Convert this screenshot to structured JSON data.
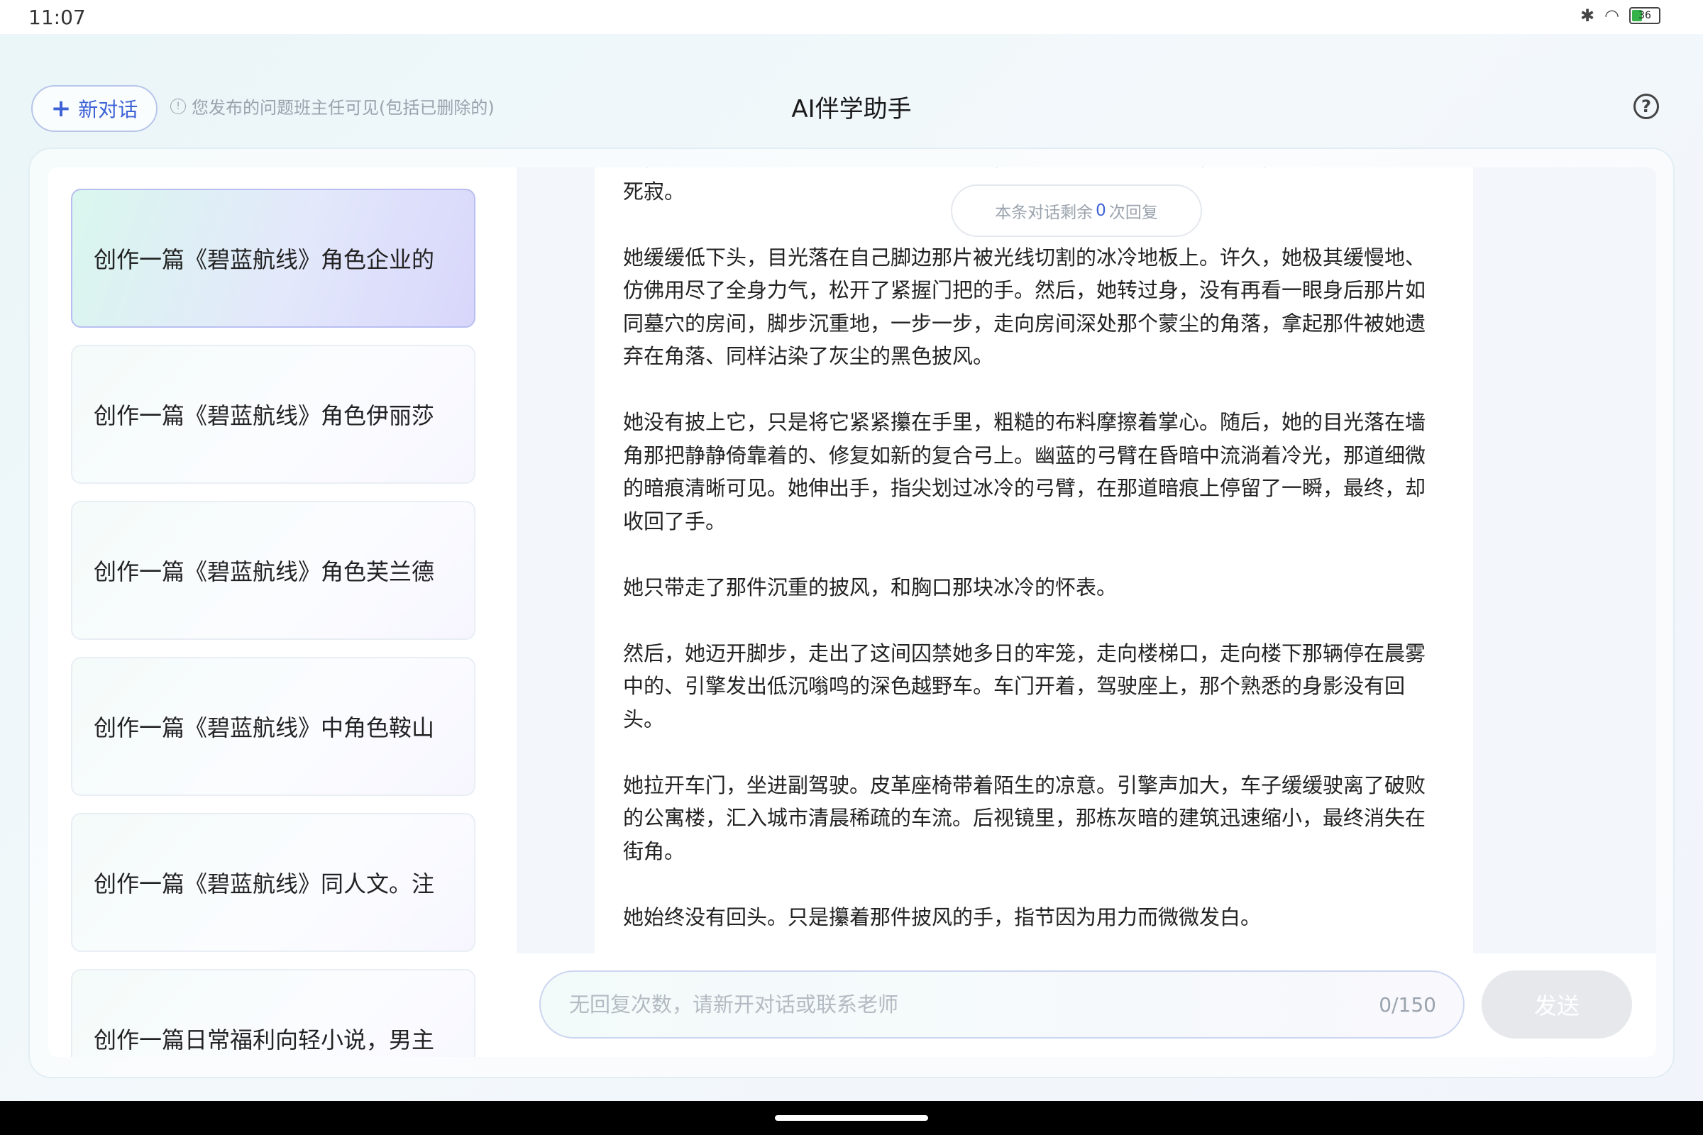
{
  "status_bar": {
    "time": "11:07",
    "battery_level": "36",
    "icons": [
      "bluetooth-icon",
      "wifi-icon",
      "battery-icon"
    ]
  },
  "header": {
    "new_chat_label": "新对话",
    "notice": "您发布的问题班主任可见(包括已删除的)",
    "title": "AI伴学助手"
  },
  "sidebar": {
    "items": [
      {
        "label": "创作一篇《碧蓝航线》角色企业的",
        "active": true
      },
      {
        "label": "创作一篇《碧蓝航线》角色伊丽莎",
        "active": false
      },
      {
        "label": "创作一篇《碧蓝航线》角色芙兰德",
        "active": false
      },
      {
        "label": "创作一篇《碧蓝航线》中角色鞍山",
        "active": false
      },
      {
        "label": "创作一篇《碧蓝航线》同人文。注",
        "active": false
      },
      {
        "label": "创作一篇日常福利向轻小说，男主",
        "active": false
      }
    ]
  },
  "chat": {
    "remaining_prefix": "本条对话剩余",
    "remaining_count": "0",
    "remaining_suffix": "次回复",
    "paragraphs": [
      "来，在地板上投下一道狭长的光带。门外，是喧嚣而陌生的世界，门内，是凝固的黑暗与死寂。",
      "她缓缓低下头，目光落在自己脚边那片被光线切割的冰冷地板上。许久，她极其缓慢地、仿佛用尽了全身力气，松开了紧握门把的手。然后，她转过身，没有再看一眼身后那片如同墓穴的房间，脚步沉重地，一步一步，走向房间深处那个蒙尘的角落，拿起那件被她遗弃在角落、同样沾染了灰尘的黑色披风。",
      "她没有披上它，只是将它紧紧攥在手里，粗糙的布料摩擦着掌心。随后，她的目光落在墙角那把静静倚靠着的、修复如新的复合弓上。幽蓝的弓臂在昏暗中流淌着冷光，那道细微的暗痕清晰可见。她伸出手，指尖划过冰冷的弓臂，在那道暗痕上停留了一瞬，最终，却收回了手。",
      "她只带走了那件沉重的披风，和胸口那块冰冷的怀表。",
      "然后，她迈开脚步，走出了这间囚禁她多日的牢笼，走向楼梯口，走向楼下那辆停在晨雾中的、引擎发出低沉嗡鸣的深色越野车。车门开着，驾驶座上，那个熟悉的身影没有回头。",
      "她拉开车门，坐进副驾驶。皮革座椅带着陌生的凉意。引擎声加大，车子缓缓驶离了破败的公寓楼，汇入城市清晨稀疏的车流。后视镜里，那栋灰暗的建筑迅速缩小，最终消失在街角。",
      "她始终没有回头。只是攥着那件披风的手，指节因为用力而微微发白。"
    ]
  },
  "input": {
    "placeholder": "无回复次数，请新开对话或联系老师",
    "char_count": "0/150",
    "send_label": "发送"
  },
  "colors": {
    "accent": "#3d62d6",
    "active_item_start": "#d9f7ee",
    "active_item_end": "#d8d6fb"
  }
}
